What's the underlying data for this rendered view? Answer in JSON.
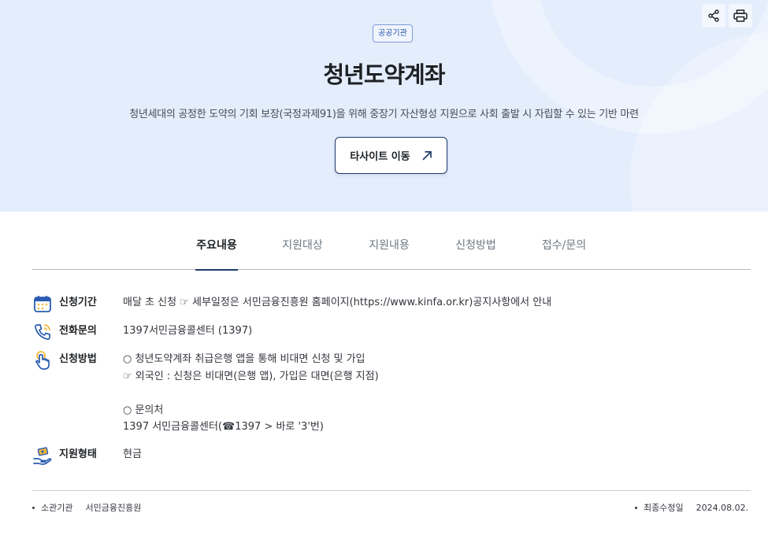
{
  "header": {
    "agency_badge": "공공기관",
    "title": "청년도약계좌",
    "description": "청년세대의 공정한 도약의 기회 보장(국정과제91)을 위해 중장기 자산형성 지원으로 사회 출발 시 자립할 수 있는 기반 마련",
    "site_button_label": "타사이트 이동",
    "toolbar": {
      "share_icon": "share-icon",
      "print_icon": "print-icon"
    }
  },
  "tabs": [
    {
      "label": "주요내용",
      "active": true
    },
    {
      "label": "지원대상",
      "active": false
    },
    {
      "label": "지원내용",
      "active": false
    },
    {
      "label": "신청방법",
      "active": false
    },
    {
      "label": "접수/문의",
      "active": false
    }
  ],
  "info": [
    {
      "icon": "calendar-icon",
      "label": "신청기간",
      "lines": [
        "매달 초 신청 ☞ 세부일정은 서민금융진흥원 홈페이지(https://www.kinfa.or.kr)공지사항에서 안내"
      ]
    },
    {
      "icon": "phone-icon",
      "label": "전화문의",
      "lines": [
        "1397서민금융콜센터 (1397)"
      ]
    },
    {
      "icon": "hand-pointer-icon",
      "label": "신청방법",
      "lines": [
        "○ 청년도약계좌 취급은행 앱을 통해 비대면 신청 및 가입",
        "☞ 외국인 : 신청은 비대면(은행 앱), 가입은 대면(은행 지점)",
        "",
        "○ 문의처",
        "1397 서민금융콜센터(☎1397 > 바로 '3'번)"
      ]
    },
    {
      "icon": "money-hand-icon",
      "label": "지원형태",
      "lines": [
        "현금"
      ]
    }
  ],
  "footer": {
    "agency_label": "소관기관",
    "agency_value": "서민금융진흥원",
    "updated_label": "최종수정일",
    "updated_value": "2024.08.02."
  },
  "colors": {
    "hero_bg": "#e4edfc",
    "accent_navy": "#1e3a6b",
    "icon_yellow": "#f3b93c",
    "icon_blue": "#2a5db0"
  }
}
